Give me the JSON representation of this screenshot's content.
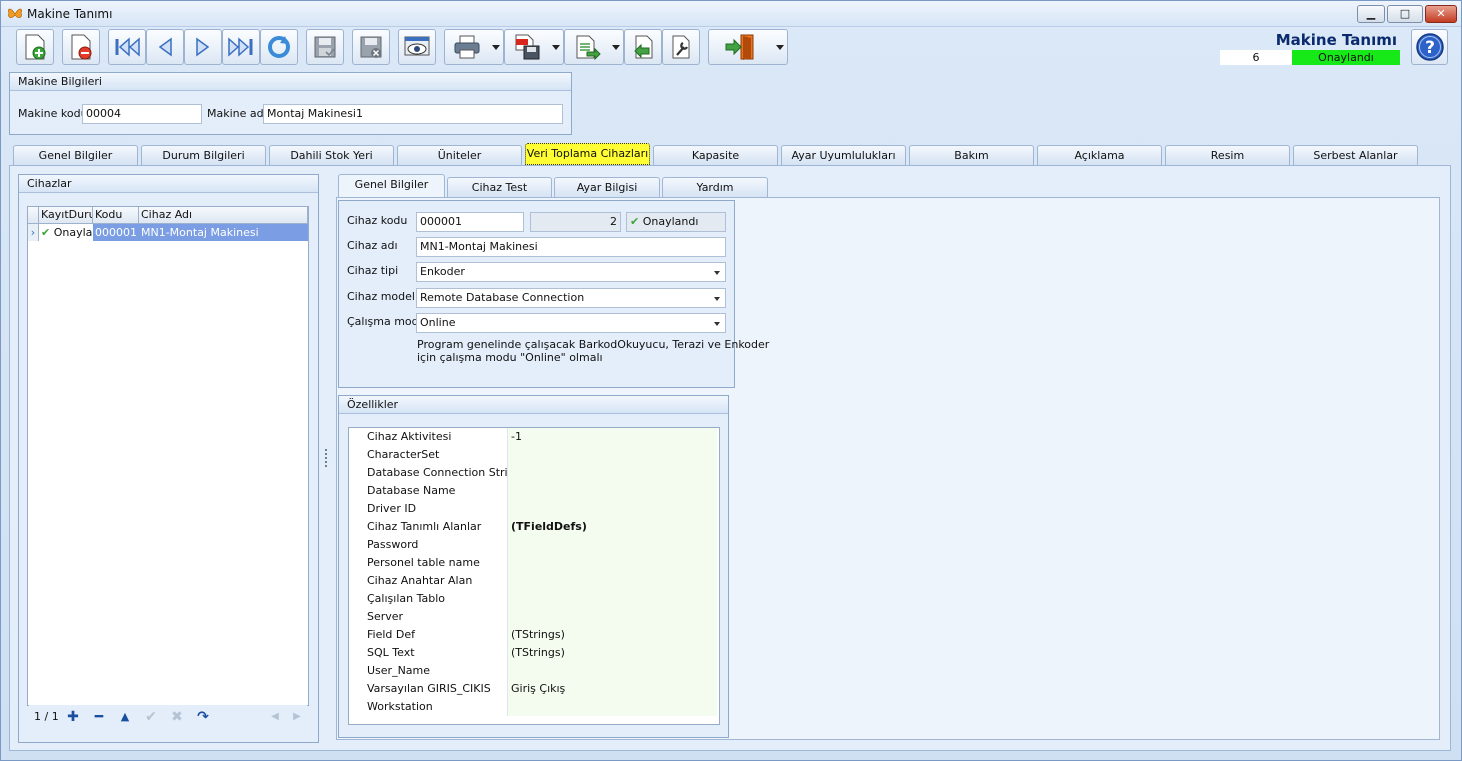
{
  "window": {
    "title": "Makine Tanımı",
    "min": "▁",
    "max": "□",
    "close": "✕"
  },
  "header": {
    "title": "Makine Tanımı",
    "count": "6",
    "status": "Onaylandı"
  },
  "machine": {
    "group_title": "Makine Bilgileri",
    "code_label": "Makine kodu",
    "code_value": "00004",
    "name_label": "Makine adı",
    "name_value": "Montaj Makinesi1"
  },
  "tabs": [
    "Genel Bilgiler",
    "Durum Bilgileri",
    "Dahili Stok Yeri",
    "Üniteler",
    "Veri Toplama Cihazları",
    "Kapasite",
    "Ayar Uyumlulukları",
    "Bakım",
    "Açıklama",
    "Resim",
    "Serbest Alanlar"
  ],
  "devices": {
    "group_title": "Cihazlar",
    "columns": [
      "KayıtDurumu",
      "Kodu",
      "Cihaz Adı"
    ],
    "rows": [
      {
        "status": "Onaylandı",
        "code": "000001",
        "name": "MN1-Montaj Makinesi"
      }
    ],
    "pager": "1 / 1"
  },
  "subtabs": [
    "Genel Bilgiler",
    "Cihaz Test",
    "Ayar Bilgisi",
    "Yardım"
  ],
  "device_form": {
    "code_label": "Cihaz kodu",
    "code_value": "000001",
    "count_value": "2",
    "status_value": "Onaylandı",
    "name_label": "Cihaz adı",
    "name_value": "MN1-Montaj Makinesi",
    "type_label": "Cihaz tipi",
    "type_value": "Enkoder",
    "model_label": "Cihaz modeli",
    "model_value": "Remote Database Connection",
    "mode_label": "Çalışma modu",
    "mode_value": "Online",
    "note_line1": "Program genelinde çalışacak BarkodOkuyucu, Terazi ve Enkoder",
    "note_line2": "için çalışma modu \"Online\" olmalı"
  },
  "properties": {
    "group_title": "Özellikler",
    "rows": [
      {
        "name": "Cihaz Aktivitesi",
        "value": "-1"
      },
      {
        "name": "CharacterSet",
        "value": ""
      },
      {
        "name": "Database Connection String",
        "value": ""
      },
      {
        "name": "Database Name",
        "value": ""
      },
      {
        "name": "Driver ID",
        "value": ""
      },
      {
        "name": "Cihaz Tanımlı Alanlar",
        "value": "(TFieldDefs)"
      },
      {
        "name": "Password",
        "value": ""
      },
      {
        "name": "Personel table name",
        "value": ""
      },
      {
        "name": "Cihaz Anahtar Alan",
        "value": ""
      },
      {
        "name": "Çalışılan Tablo",
        "value": ""
      },
      {
        "name": "Server",
        "value": ""
      },
      {
        "name": "Field Def",
        "value": "(TStrings)"
      },
      {
        "name": "SQL Text",
        "value": "(TStrings)"
      },
      {
        "name": "User_Name",
        "value": ""
      },
      {
        "name": "Varsayılan GIRIS_CIKIS",
        "value": "Giriş Çıkış"
      },
      {
        "name": "Workstation",
        "value": ""
      }
    ]
  },
  "colors": {
    "approved_green": "#17e817",
    "active_tab": "#ffff33",
    "selected_row": "#7b9de3",
    "title_blue": "#0b2a6e"
  }
}
